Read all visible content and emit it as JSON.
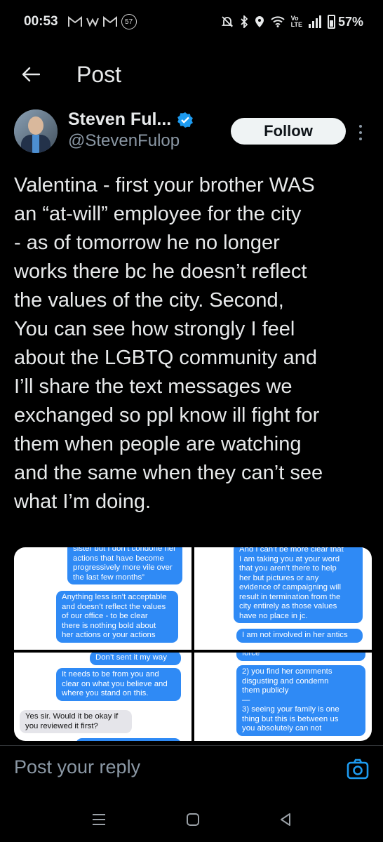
{
  "status_bar": {
    "time": "00:53",
    "left_icons": [
      "gmail-icon",
      "w-icon",
      "gmail-icon"
    ],
    "badge": "57",
    "volte": "Vo\nLTE",
    "battery": "57%"
  },
  "header": {
    "title": "Post"
  },
  "author": {
    "display_name": "Steven Ful...",
    "handle": "@StevenFulop",
    "verified": true,
    "follow_label": "Follow"
  },
  "tweet": {
    "text": "Valentina - first your brother WAS\nan “at-will” employee for the city\n- as of tomorrow he no longer\nworks there bc he doesn’t reflect\nthe values of the city. Second,\nYou can see how strongly I feel\nabout the LGBTQ community and\nI’ll share the text messages we\nexchanged so ppl know ill fight for\nthem when people are watching\nand the same when they can’t see\nwhat I’m doing."
  },
  "media": {
    "panel1": [
      {
        "type": "blue",
        "text": "sister but I don’t condone her\nactions that have become\nprogressively more vile over\nthe last few months”"
      },
      {
        "type": "blue",
        "text": "Anything less isn’t acceptable\nand doesn’t reflect the values\nof our office - to be clear\nthere is nothing bold about\nher actions or your actions"
      }
    ],
    "panel2": [
      {
        "type": "blue",
        "text": "And I can’t be more clear that\nI am taking you at your word\nthat you aren’t there to help\nher but pictures or any\nevidence of campaigning will\nresult in termination from the\ncity entirely as those values\nhave no place in jc."
      },
      {
        "type": "blue",
        "text": "I am not involved in her antics"
      }
    ],
    "panel3": [
      {
        "type": "blue",
        "text": "Don’t sent it my way"
      },
      {
        "type": "blue",
        "text": "It needs to be from you and\nclear on what you believe and\nwhere you stand on this."
      },
      {
        "type": "grey",
        "text": "Yes sir. Would it be okay if\nyou reviewed it first?"
      }
    ],
    "panel4": [
      {
        "type": "blue",
        "text": "force"
      },
      {
        "type": "blue",
        "text": "2) you find her comments\ndisgusting and condemn\nthem publicly\n—\n3) seeing your family is one\nthing but this is between us\nyou absolutely can not"
      }
    ]
  },
  "reply": {
    "placeholder": "Post your reply"
  },
  "colors": {
    "background": "#000000",
    "text": "#e7e9ea",
    "secondary": "#8b98a5",
    "accent": "#1d9bf0",
    "imessage_blue": "#2f8af5"
  }
}
